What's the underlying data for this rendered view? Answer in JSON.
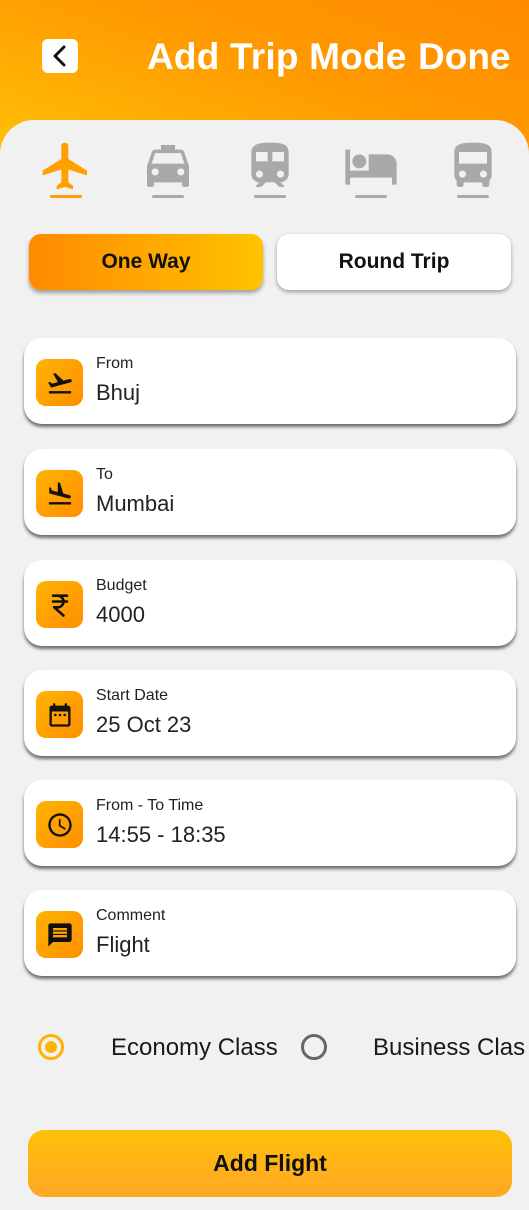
{
  "header": {
    "title": "Add Trip Mode",
    "done_label": "Done"
  },
  "modes": [
    {
      "icon": "flight-icon",
      "active": true
    },
    {
      "icon": "taxi-icon",
      "active": false
    },
    {
      "icon": "train-icon",
      "active": false
    },
    {
      "icon": "hotel-icon",
      "active": false
    },
    {
      "icon": "bus-icon",
      "active": false
    }
  ],
  "trip_type": {
    "one_way": "One Way",
    "round_trip": "Round Trip",
    "selected": "One Way"
  },
  "fields": {
    "from": {
      "label": "From",
      "value": "Bhuj",
      "icon": "flight-takeoff-icon"
    },
    "to": {
      "label": "To",
      "value": "Mumbai",
      "icon": "flight-land-icon"
    },
    "budget": {
      "label": "Budget",
      "value": "4000",
      "icon": "rupee-icon"
    },
    "start_date": {
      "label": "Start Date",
      "value": "25 Oct 23",
      "icon": "calendar-icon"
    },
    "time": {
      "label": "From - To Time",
      "value": "14:55 - 18:35",
      "icon": "clock-icon"
    },
    "comment": {
      "label": "Comment",
      "value": "Flight",
      "icon": "comment-icon"
    }
  },
  "travel_class": {
    "economy": "Economy Class",
    "business": "Business Clas",
    "selected": "Economy Class"
  },
  "submit_label": "Add Flight",
  "colors": {
    "accent": "#ffa000",
    "accent_light": "#ffc107",
    "inactive_icon": "#a9a9a9"
  }
}
